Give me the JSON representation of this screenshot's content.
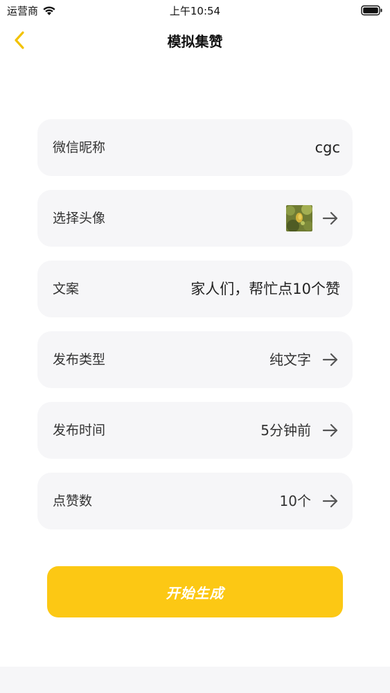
{
  "status_bar": {
    "carrier": "运营商",
    "time": "上午10:54"
  },
  "nav": {
    "title": "模拟集赞"
  },
  "rows": [
    {
      "label": "微信昵称",
      "value": "cgc"
    },
    {
      "label": "选择头像",
      "value": ""
    },
    {
      "label": "文案",
      "value": "家人们，帮忙点10个赞"
    },
    {
      "label": "发布类型",
      "value": "纯文字"
    },
    {
      "label": "发布时间",
      "value": "5分钟前"
    },
    {
      "label": "点赞数",
      "value": "10个"
    }
  ],
  "primary_button": {
    "label": "开始生成"
  },
  "colors": {
    "accent": "#fcc814",
    "row_background": "#f6f6f8",
    "back_arrow": "#f2c200"
  }
}
